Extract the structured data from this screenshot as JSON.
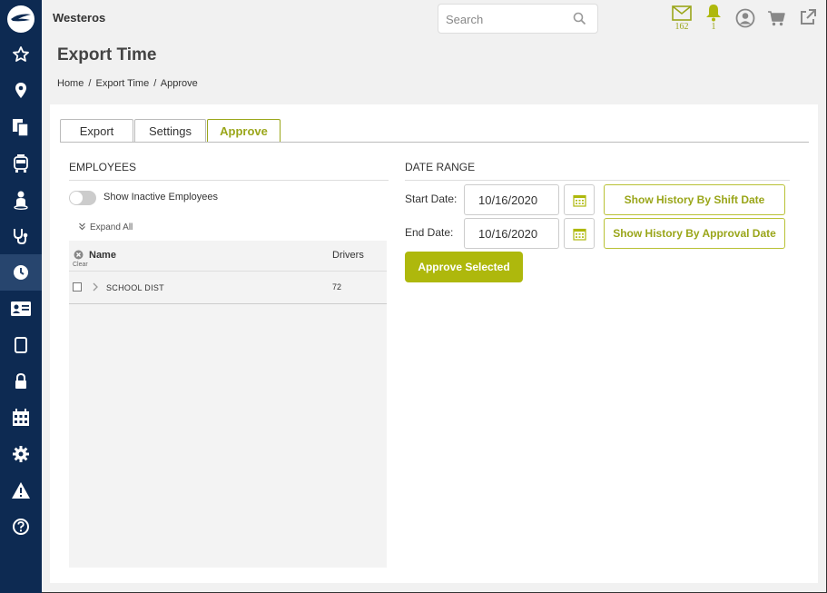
{
  "header": {
    "org_name": "Westeros",
    "search_placeholder": "Search",
    "mail_count": "162",
    "alert_count": "1"
  },
  "page": {
    "title": "Export Time",
    "breadcrumb": [
      "Home",
      "/",
      "Export Time",
      "/",
      "Approve"
    ]
  },
  "tabs": [
    {
      "label": "Export",
      "active": false
    },
    {
      "label": "Settings",
      "active": false
    },
    {
      "label": "Approve",
      "active": true
    }
  ],
  "employees": {
    "section_title": "EMPLOYEES",
    "toggle_label": "Show Inactive Employees",
    "expand_all": "Expand All",
    "clear_label": "Clear",
    "columns": {
      "name": "Name",
      "drivers": "Drivers"
    },
    "rows": [
      {
        "name": "SCHOOL DIST",
        "drivers": "72"
      }
    ]
  },
  "date_range": {
    "section_title": "DATE RANGE",
    "start_label": "Start Date:",
    "start_value": "10/16/2020",
    "end_label": "End Date:",
    "end_value": "10/16/2020",
    "shift_button": "Show History By Shift Date",
    "approval_button": "Show History By Approval Date",
    "approve_button": "Approve Selected"
  },
  "colors": {
    "sidebar": "#0d2a52",
    "accent": "#aeb80c"
  }
}
